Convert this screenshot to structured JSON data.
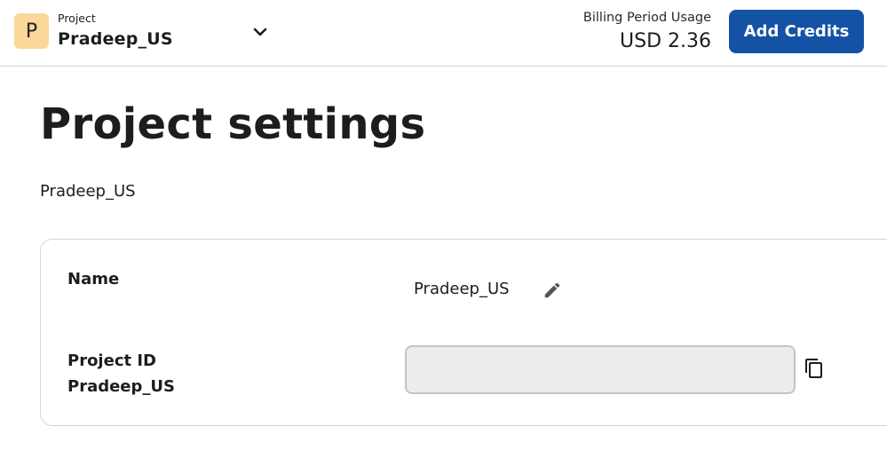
{
  "header": {
    "avatar_letter": "P",
    "project_caption": "Project",
    "project_name": "Pradeep_US",
    "billing_label": "Billing Period Usage",
    "billing_value": "USD 2.36",
    "add_credits_label": "Add Credits",
    "add_credits_color": "#1452a6",
    "avatar_color": "#fbd89a",
    "dropdown_icon": "chevron-down-icon"
  },
  "page": {
    "title": "Project settings",
    "subtitle": "Pradeep_US"
  },
  "settings": {
    "name_label": "Name",
    "name_value": "Pradeep_US",
    "edit_icon": "pencil-icon",
    "project_id_label": "Project ID",
    "project_id_name": "Pradeep_US",
    "project_id_value": "",
    "copy_icon": "copy-icon"
  }
}
